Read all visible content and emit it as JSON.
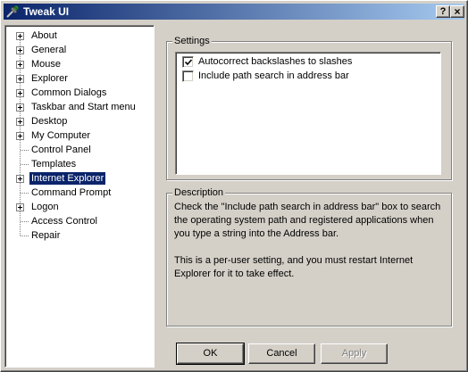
{
  "window": {
    "title": "Tweak UI",
    "icon": "tweakui-app-icon",
    "help_button": "?",
    "close_button": "×"
  },
  "tree": {
    "items": [
      {
        "label": "About",
        "expandable": true
      },
      {
        "label": "General",
        "expandable": true
      },
      {
        "label": "Mouse",
        "expandable": true
      },
      {
        "label": "Explorer",
        "expandable": true
      },
      {
        "label": "Common Dialogs",
        "expandable": true
      },
      {
        "label": "Taskbar and Start menu",
        "expandable": true
      },
      {
        "label": "Desktop",
        "expandable": true
      },
      {
        "label": "My Computer",
        "expandable": true
      },
      {
        "label": "Control Panel",
        "expandable": false
      },
      {
        "label": "Templates",
        "expandable": false
      },
      {
        "label": "Internet Explorer",
        "expandable": true,
        "selected": true
      },
      {
        "label": "Command Prompt",
        "expandable": false
      },
      {
        "label": "Logon",
        "expandable": true
      },
      {
        "label": "Access Control",
        "expandable": false
      },
      {
        "label": "Repair",
        "expandable": false
      }
    ]
  },
  "settings": {
    "label": "Settings",
    "items": [
      {
        "label": "Autocorrect backslashes to slashes",
        "checked": true
      },
      {
        "label": "Include path search in address bar",
        "checked": false
      }
    ]
  },
  "description": {
    "label": "Description",
    "paragraphs": [
      "Check the \"Include path search in address bar\" box to search the operating system path and registered applications when you type a string into the Address bar.",
      "This is a per-user setting, and you must restart Internet Explorer for it to take effect."
    ]
  },
  "buttons": {
    "ok": "OK",
    "cancel": "Cancel",
    "apply": "Apply"
  },
  "colors": {
    "titlebar_start": "#0a246a",
    "titlebar_end": "#a6caf0",
    "selection": "#0a246a",
    "face": "#d4d0c8"
  }
}
